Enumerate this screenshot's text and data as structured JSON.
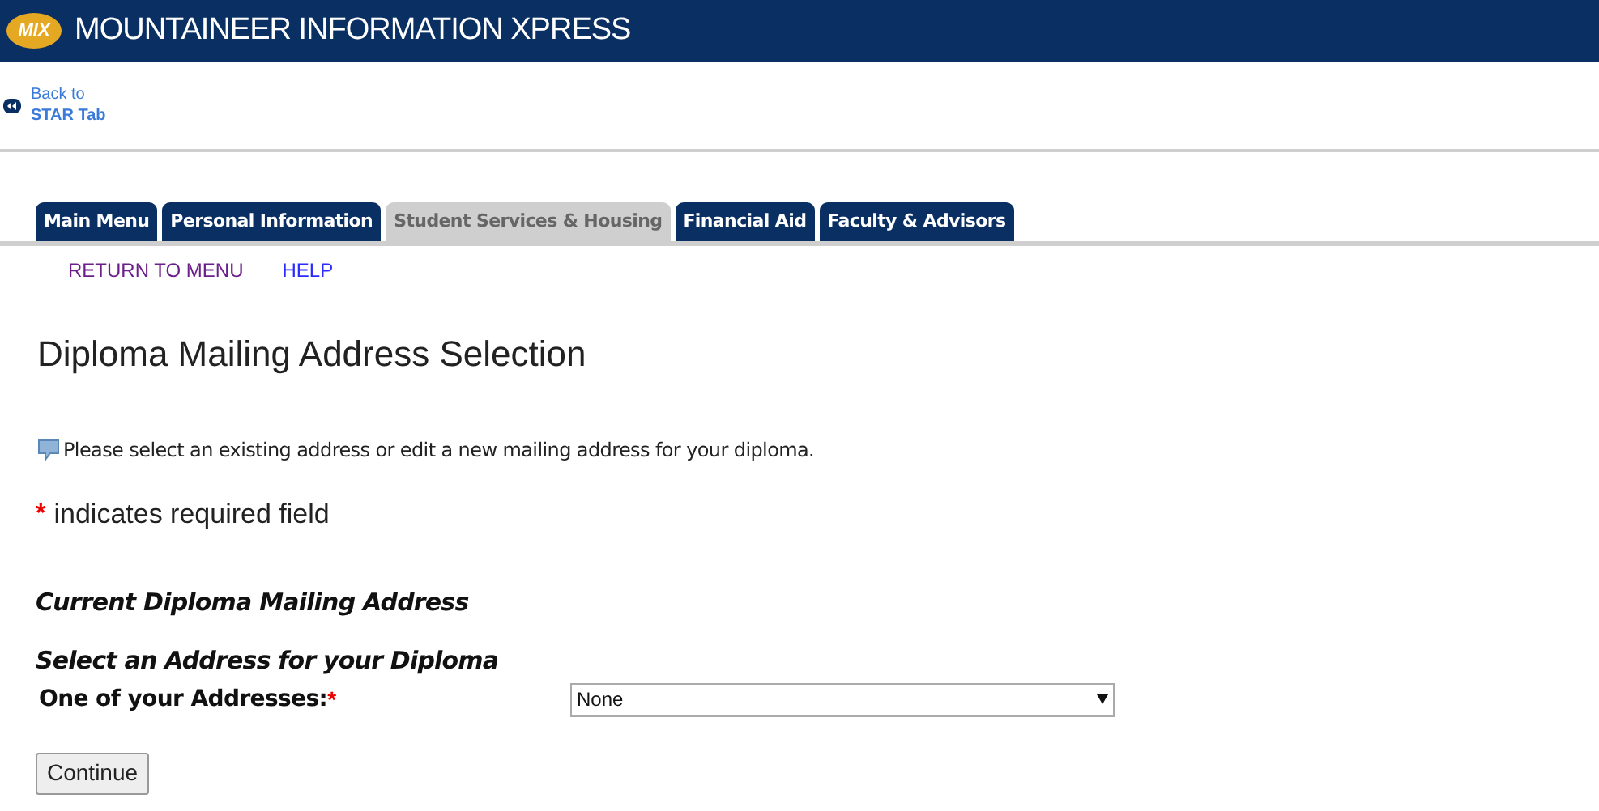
{
  "header": {
    "logo_text": "MIX",
    "title": "MOUNTAINEER INFORMATION XPRESS"
  },
  "back_link": {
    "line1": "Back to",
    "line2": "STAR Tab"
  },
  "tabs": [
    {
      "label": "Main Menu",
      "selected": false
    },
    {
      "label": "Personal Information",
      "selected": false
    },
    {
      "label": "Student Services & Housing",
      "selected": true
    },
    {
      "label": "Financial Aid",
      "selected": false
    },
    {
      "label": "Faculty & Advisors",
      "selected": false
    }
  ],
  "sub_links": [
    {
      "label": "RETURN TO MENU",
      "visited": true
    },
    {
      "label": "HELP",
      "visited": false
    }
  ],
  "page_title": "Diploma Mailing Address Selection",
  "info_text": "Please select an existing address or edit a new mailing address for your diploma.",
  "required_note": {
    "mark": "*",
    "text": "indicates required field"
  },
  "section_current": "Current Diploma Mailing Address",
  "section_select": "Select an Address for your Diploma",
  "address_field": {
    "label": "One of your Addresses:",
    "mark": "*",
    "value": "None"
  },
  "continue_button": "Continue"
}
